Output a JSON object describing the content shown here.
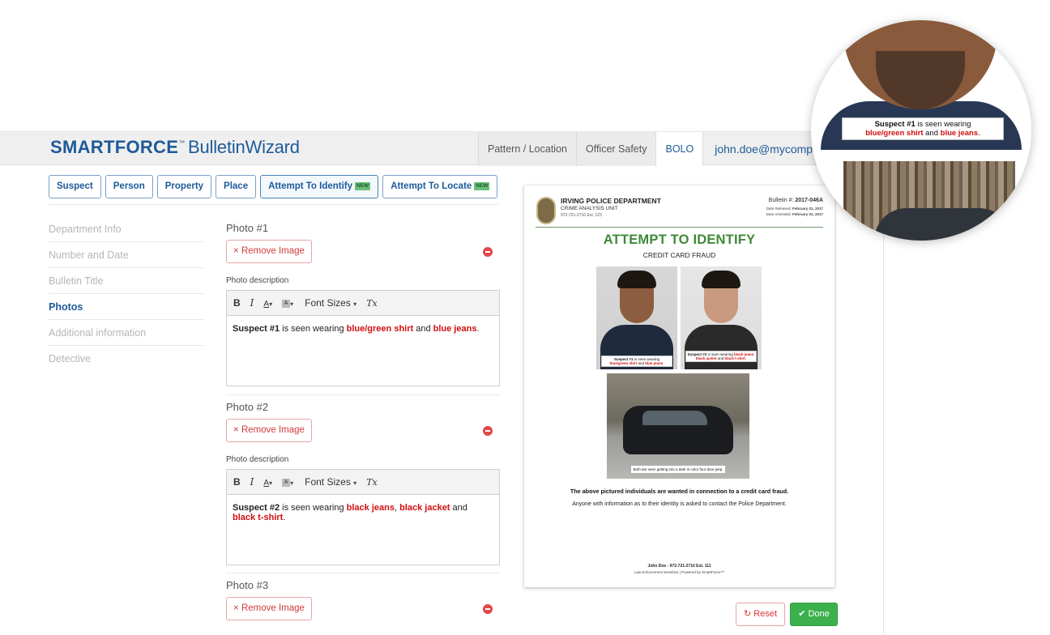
{
  "header": {
    "brand_main": "SMARTFORCE",
    "brand_tm": "™",
    "brand_product": "BulletinWizard",
    "tabs": [
      "Pattern / Location",
      "Officer Safety",
      "BOLO"
    ],
    "user_email": "john.doe@mycompany.c"
  },
  "subnav": {
    "buttons": [
      "Suspect",
      "Person",
      "Property",
      "Place",
      "Attempt To Identify",
      "Attempt To Locate"
    ],
    "new_badge": "NEW"
  },
  "sidemenu": {
    "items": [
      "Department Info",
      "Number and Date",
      "Bulletin Title",
      "Photos",
      "Additional information",
      "Detective"
    ]
  },
  "photos": {
    "remove_label": "Remove Image",
    "remove_icon": "×",
    "desc_label": "Photo description",
    "toolbar": {
      "bold": "B",
      "italic": "I",
      "font_color": "A",
      "bg_color": "A",
      "font_sizes": "Font Sizes",
      "clear": "Tx"
    },
    "items": [
      {
        "title": "Photo #1",
        "desc_prefix": "Suspect #1",
        "desc_mid": " is seen wearing ",
        "desc_red1": "blue/green shirt",
        "desc_and": " and ",
        "desc_red2": "blue jeans",
        "desc_end": "."
      },
      {
        "title": "Photo #2",
        "desc_prefix": "Suspect #2",
        "desc_mid": " is seen wearing ",
        "desc_red1": "black jeans",
        "desc_comma": ", ",
        "desc_red2": "black jacket",
        "desc_and": " and ",
        "desc_red3": "black t-shirt",
        "desc_end": "."
      },
      {
        "title": "Photo #3"
      }
    ]
  },
  "bulletin": {
    "dept": "IRVING POLICE DEPARTMENT",
    "unit": "CRIME ANALYSIS UNIT",
    "phone": "972-721-2710 Ext. 123",
    "number_label": "Bulletin #: ",
    "number": "2017-046A",
    "released_label": "Date Released: ",
    "released": "February 01, 2017",
    "amended_label": "Date Amended: ",
    "amended": "February 01, 2017",
    "title": "ATTEMPT TO IDENTIFY",
    "subtitle": "CREDIT CARD FRAUD",
    "cap1_prefix": "Suspect #1",
    "cap1_mid": " is seen wearing ",
    "cap1_red1": "blue/green shirt",
    "cap1_and": " and ",
    "cap1_red2": "blue jeans",
    "cap1_end": ".",
    "cap2_prefix": "Suspect #2",
    "cap2_mid": " is seen wearing ",
    "cap2_red1": "black jeans",
    "cap2_comma": ", ",
    "cap2_red2": "black jacket",
    "cap2_and": " and ",
    "cap2_red3": "black t-shirt",
    "cap2_end": ".",
    "vehicle_caption": "Both are seen getting into a dark in color four door jeep.",
    "wanted": "The above pictured individuals are wanted in connection to a credit card fraud.",
    "anyone": "Anyone with information as to their identity is asked to contact the Police Department.",
    "footer_contact": "John Doe - 972-721-2710 Ext. 111",
    "footer_note": "Law Enforcement Sensitive | Powered by SmartForce™"
  },
  "actions": {
    "reset_icon": "↻",
    "reset": "Reset",
    "done_icon": "✔",
    "done": "Done"
  },
  "magnifier": {
    "cap_prefix": "Suspect #1",
    "cap_mid": " is seen wearing",
    "cap_red1": "blue/green shirt",
    "cap_and": " and ",
    "cap_red2": "blue jeans",
    "cap_end": "."
  },
  "colors": {
    "brand_blue": "#1e5a99",
    "title_green": "#3f8a3a",
    "danger_red": "#d10f0f",
    "done_green": "#3cb04d"
  }
}
